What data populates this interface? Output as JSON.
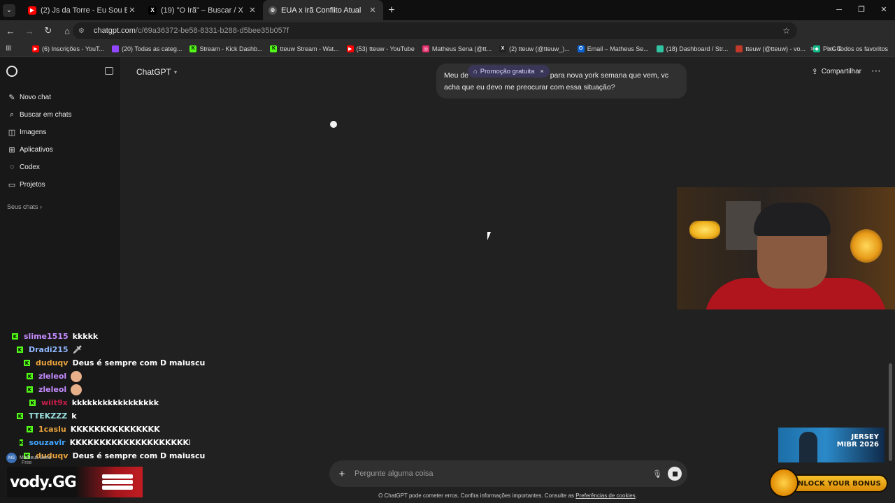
{
  "browser": {
    "tabs": [
      {
        "title": "(2) Js da Torre - Eu Sou Eu (Pro",
        "favicon": "youtube-icon",
        "color": "#ff0000",
        "active": false
      },
      {
        "title": "(19) \"O Irã\" – Buscar / X",
        "favicon": "x-icon",
        "color": "#000000",
        "active": false
      },
      {
        "title": "EUA x Irã Conflito Atual",
        "favicon": "chatgpt-icon",
        "color": "#444444",
        "active": true
      }
    ],
    "address": {
      "host": "chatgpt.com",
      "path": "/c/69a36372-be58-8331-b288-d5bee35b057f"
    },
    "profile_initial": "M",
    "bookmarks": [
      {
        "label": "(6) Inscrições - YouT...",
        "icon": "youtube-icon",
        "color": "#ff0000"
      },
      {
        "label": "(20) Todas as categ...",
        "icon": "twitch-icon",
        "color": "#9146ff"
      },
      {
        "label": "Stream - Kick Dashb...",
        "icon": "kick-icon",
        "color": "#53fc18"
      },
      {
        "label": "tteuw Stream - Wat...",
        "icon": "kick-icon",
        "color": "#53fc18"
      },
      {
        "label": "(53) tteuw - YouTube",
        "icon": "youtube-icon",
        "color": "#ff0000"
      },
      {
        "label": "Matheus Sena (@tt...",
        "icon": "instagram-icon",
        "color": "#e1306c"
      },
      {
        "label": "(2) tteuw (@tteuw_)...",
        "icon": "x-icon",
        "color": "#222222"
      },
      {
        "label": "Email – Matheus Se...",
        "icon": "outlook-icon",
        "color": "#0a64d8"
      },
      {
        "label": "(18) Dashboard / Str...",
        "icon": "streamlabs-icon",
        "color": "#31c3a2"
      },
      {
        "label": "tteuw (@tteuw) - vo...",
        "icon": "streamelements-icon",
        "color": "#c0392b"
      },
      {
        "label": "PixGG",
        "icon": "pixgg-icon",
        "color": "#12b886"
      }
    ],
    "all_bookmarks_label": "Todos os favoritos"
  },
  "sidebar": {
    "items": [
      {
        "label": "Novo chat",
        "icon": "edit-icon"
      },
      {
        "label": "Buscar em chats",
        "icon": "search-icon"
      },
      {
        "label": "Imagens",
        "icon": "image-icon"
      },
      {
        "label": "Aplicativos",
        "icon": "apps-icon"
      },
      {
        "label": "Codex",
        "icon": "codex-icon"
      },
      {
        "label": "Projetos",
        "icon": "folder-icon"
      }
    ],
    "section_label": "Seus chats"
  },
  "header": {
    "model_label": "ChatGPT",
    "share_label": "Compartilhar"
  },
  "conversation": {
    "user_message": "Meu de                                        para nova york semana que vem, vc acha que eu devo me preocurar com essa situação?",
    "promo_label": "Promoção gratuita"
  },
  "composer": {
    "placeholder": "Pergunte alguma coisa",
    "disclaimer": "O ChatGPT pode cometer erros. Confira informações importantes. Consulte as",
    "disclaimer_link": "Preferências de cookies",
    "disclaimer_end": "."
  },
  "stream_chat": [
    {
      "user": "slime1515",
      "color": "#c58cff",
      "msg": "kkkkk",
      "kick": true
    },
    {
      "user": "Dradi215",
      "color": "#8fb7ff",
      "msg": "",
      "emote": "sword-emote",
      "kick": true
    },
    {
      "user": "duduqv",
      "color": "#e8a23c",
      "msg": "Deus é sempre com D maiuscu",
      "kick": true
    },
    {
      "user": "zleleol",
      "color": "#c58cff",
      "msg": "",
      "emote": "face-emote",
      "kick": true
    },
    {
      "user": "zleleol",
      "color": "#c58cff",
      "msg": "",
      "emote": "face-emote",
      "kick": true
    },
    {
      "user": "wiit9x",
      "color": "#c81e4a",
      "msg": "kkkkkkkkkkkkkkkkk",
      "kick": true
    },
    {
      "user": "TTEKZZZ",
      "color": "#9ae0e0",
      "msg": "k",
      "kick": true
    },
    {
      "user": "1caslu",
      "color": "#e8a23c",
      "msg": "KKKKKKKKKKKKKKK",
      "kick": true
    },
    {
      "user": "souzavlr",
      "color": "#3fa3ff",
      "msg": "KKKKKKKKKKKKKKKKKKKKKK",
      "kick": true
    },
    {
      "user": "duduqv",
      "color": "#e8a23c",
      "msg": "Deus é sempre com D maiuscu",
      "kick": true
    }
  ],
  "user_badge": {
    "initials": "MS",
    "name": "Matheus Sena",
    "plan": "Free"
  },
  "overlays": {
    "vody_logo": "vody.GG",
    "vody_suffix": "/t",
    "jersey_lines": [
      "JERSEY",
      "MIBR 2026"
    ],
    "unlock_label": "UNLOCK YOUR BONUS"
  }
}
